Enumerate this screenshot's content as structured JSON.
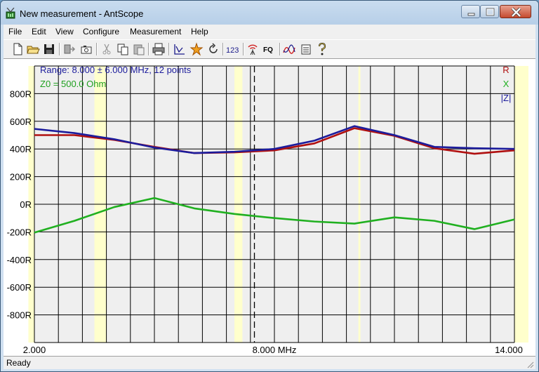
{
  "window": {
    "title": "New measurement - AntScope"
  },
  "menu": [
    "File",
    "Edit",
    "View",
    "Configure",
    "Measurement",
    "Help"
  ],
  "toolbar": {
    "icons": [
      "new-file-icon",
      "open-folder-icon",
      "save-icon",
      "export-icon",
      "camera-icon",
      "cut-icon",
      "copy-icon",
      "paste-icon",
      "print-icon",
      "chart-icon",
      "star-icon",
      "refresh-icon",
      "number-icon",
      "antenna-icon",
      "frequency-icon",
      "curves-icon",
      "list-icon",
      "help-icon"
    ],
    "numbers_label": "123",
    "fq_label": "FQ"
  },
  "chart_data": {
    "type": "line",
    "info_range": "Range: 8.000 ± 6.000 MHz, 12 points",
    "info_z0": "Z0 = 500.0 Ohm",
    "x": [
      2,
      3.0909,
      4.1818,
      5.2727,
      6.3636,
      7.4545,
      8.5455,
      9.6364,
      10.7273,
      11.8182,
      12.9091,
      14
    ],
    "xlim": [
      2,
      14
    ],
    "ylim": [
      -1000,
      1000
    ],
    "y_ticks": [
      {
        "v": 800,
        "label": "800R"
      },
      {
        "v": 600,
        "label": "600R"
      },
      {
        "v": 400,
        "label": "400R"
      },
      {
        "v": 200,
        "label": "200R"
      },
      {
        "v": 0,
        "label": "0R"
      },
      {
        "v": -200,
        "label": "-200R"
      },
      {
        "v": -400,
        "label": "-400R"
      },
      {
        "v": -600,
        "label": "-600R"
      },
      {
        "v": -800,
        "label": "-800R"
      }
    ],
    "x_tick_labels": [
      {
        "v": 2,
        "label": "2.000"
      },
      {
        "v": 8,
        "label": "8.000 MHz"
      },
      {
        "v": 14,
        "label": "14.000"
      }
    ],
    "center_marker": 7.5,
    "grid": true,
    "highlight_bands": [
      [
        1.85,
        2.0
      ],
      [
        3.5,
        3.8
      ],
      [
        7.0,
        7.2
      ],
      [
        10.1,
        10.15
      ],
      [
        14.0,
        14.35
      ]
    ],
    "legend_position": "top-right",
    "series": [
      {
        "name": "R",
        "color": "#b01010",
        "values": [
          500,
          500,
          465,
          415,
          370,
          375,
          390,
          440,
          550,
          495,
          405,
          365,
          390
        ]
      },
      {
        "name": "X",
        "color": "#20b020",
        "values": [
          -205,
          -120,
          -20,
          45,
          -30,
          -70,
          -100,
          -125,
          -140,
          -95,
          -120,
          -180,
          -110
        ]
      },
      {
        "name": "|Z|",
        "color": "#1c1c9c",
        "values": [
          545,
          515,
          470,
          410,
          370,
          380,
          400,
          460,
          565,
          500,
          415,
          405,
          400
        ]
      }
    ],
    "series_x": [
      2,
      3,
      4,
      5,
      6,
      7,
      8,
      9,
      10,
      11,
      12,
      13,
      14
    ]
  },
  "status": {
    "text": "Ready"
  }
}
